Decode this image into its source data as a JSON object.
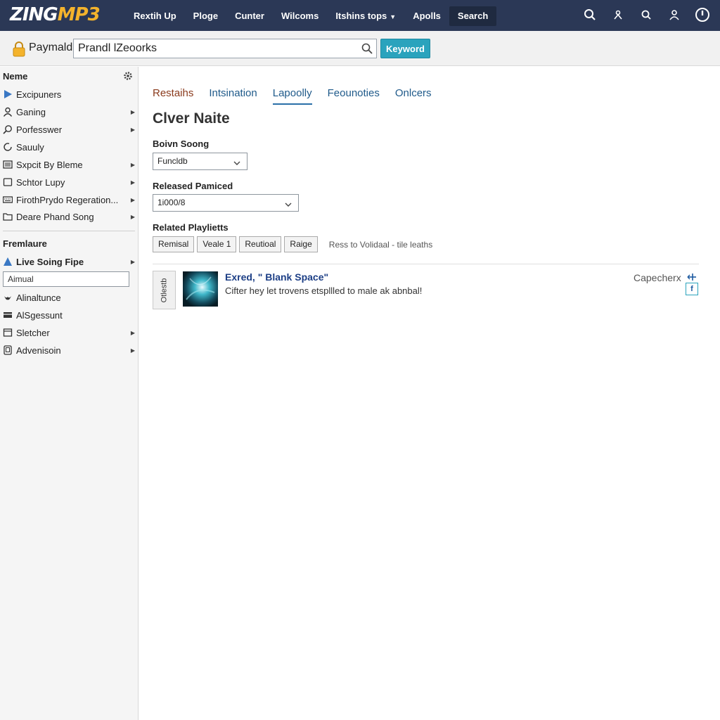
{
  "logo": {
    "zing": "ZING",
    "mp3": "MP3"
  },
  "nav": {
    "items": [
      "Rextih Up",
      "Ploge",
      "Cunter",
      "Wilcoms",
      "Itshins tops",
      "Apolls",
      "Search"
    ]
  },
  "search": {
    "label": "Paymald",
    "value": "Prandl lZeoorks",
    "button": "Keyword"
  },
  "sidebar": {
    "heading1": "Neme",
    "items1": [
      {
        "label": "Excipuners",
        "icon": "play-triangle-icon"
      },
      {
        "label": "Ganing",
        "icon": "user-icon"
      },
      {
        "label": "Porfesswer",
        "icon": "search-icon"
      },
      {
        "label": "Sauuly",
        "icon": "refresh-icon"
      },
      {
        "label": "Sxpcit By Bleme",
        "icon": "list-icon"
      },
      {
        "label": "Schtor Lupy",
        "icon": "square-icon"
      },
      {
        "label": "FirothPrydo Regeration...",
        "icon": "keyboard-icon"
      },
      {
        "label": "Deare Phand Song",
        "icon": "folder-icon"
      }
    ],
    "heading2": "Fremlaure",
    "items2": [
      {
        "label": "Live Soing Fipe",
        "icon": "triangle-icon"
      },
      {
        "label": "Alinaltunce",
        "icon": "bird-icon"
      },
      {
        "label": "AlSgessunt",
        "icon": "card-icon"
      },
      {
        "label": "Sletcher",
        "icon": "window-icon"
      },
      {
        "label": "Advenisoin",
        "icon": "tablet-icon"
      }
    ],
    "field_value": "Aimual"
  },
  "main": {
    "tabs": [
      "Restaihs",
      "Intsination",
      "Lapoolly",
      "Feounoties",
      "Onlcers"
    ],
    "title": "Clver Naite",
    "field1_label": "Boivn Soong",
    "field1_value": "Funcldb",
    "field2_label": "Released Pamiced",
    "field2_value": "1i000/8",
    "playlists_label": "Related Playlietts",
    "chips": [
      "Remisal",
      "Veale 1",
      "Reutioal",
      "Raige"
    ],
    "chips_note": "Ress to Volidaal  -  tile leaths",
    "result": {
      "badge": "Otlestb",
      "title": "Exred, \" Blank Space\"",
      "desc": "Cifter hey let trovens etspllled to male ak abnbal!",
      "right": "Capecherx"
    }
  },
  "colors": {
    "topbar": "#2b3856",
    "accent": "#2aa3bd",
    "logo_mp3": "#f4b32c",
    "link": "#1f5a8a"
  }
}
